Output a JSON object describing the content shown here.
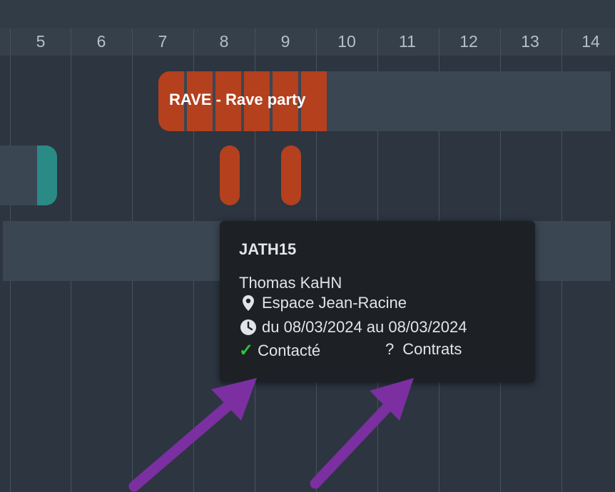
{
  "timeline": {
    "days": [
      "5",
      "6",
      "7",
      "8",
      "9",
      "10",
      "11",
      "12",
      "13",
      "14"
    ]
  },
  "events": {
    "rave_label": "RAVE - Rave party"
  },
  "tooltip": {
    "code": "JATH15",
    "person": "Thomas KaHN",
    "location": "Espace Jean-Racine",
    "dates": "du 08/03/2024 au 08/03/2024",
    "status_contact": "Contacté",
    "status_contracts": "Contrats",
    "status_contracts_mark": "?"
  },
  "colors": {
    "event_orange": "#b4401e",
    "event_teal": "#2a8a85",
    "check_green": "#2fc53b",
    "arrow_purple": "#7b2fa0"
  },
  "icons": {
    "location": "map-pin-icon",
    "time": "clock-icon",
    "contacted": "checkmark-icon"
  }
}
